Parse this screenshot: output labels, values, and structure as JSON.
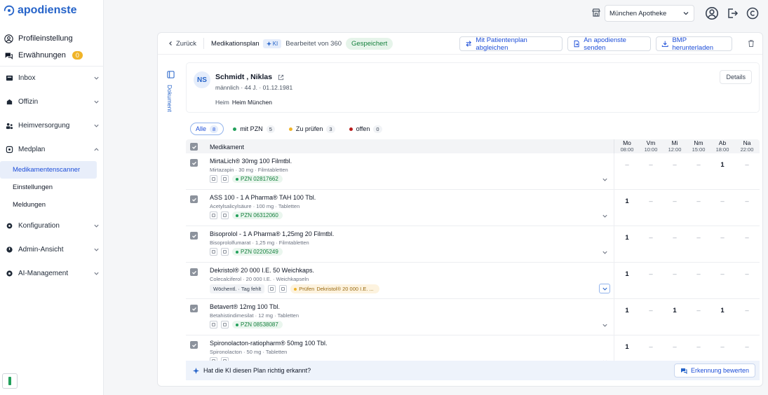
{
  "brand": {
    "name": "apodienste",
    "color": "#2563c9"
  },
  "sidebar": {
    "profile": "Profileinstellung",
    "mentions": {
      "label": "Erwähnungen",
      "count": "0"
    },
    "nav": [
      {
        "label": "Inbox",
        "icon": "inbox-icon"
      },
      {
        "label": "Offizin",
        "icon": "store-icon"
      },
      {
        "label": "Heimversorgung",
        "icon": "people-icon"
      },
      {
        "label": "Medplan",
        "icon": "medplan-icon",
        "expanded": true
      }
    ],
    "sub": [
      {
        "label": "Medikamentenscanner",
        "active": true
      },
      {
        "label": "Einstellungen"
      },
      {
        "label": "Meldungen"
      }
    ],
    "nav2": [
      {
        "label": "Konfiguration",
        "icon": "gear-icon"
      },
      {
        "label": "Admin-Ansicht",
        "icon": "shield-icon"
      },
      {
        "label": "AI-Management",
        "icon": "ai-icon"
      }
    ]
  },
  "topbar": {
    "pharmacy": "München Apotheke"
  },
  "header": {
    "back": "Zurück",
    "title": "Medikationsplan",
    "ki": "KI",
    "edited": "Bearbeitet von 360",
    "status": "Gespeichert",
    "btn_compare": "Mit Patientenplan abgleichen",
    "btn_send": "An apodienste senden",
    "btn_download": "BMP herunterladen"
  },
  "doc_tab": "Dokument",
  "patient": {
    "initials": "NS",
    "name": "Schmidt , Niklas",
    "gender": "männlich",
    "age": "44 J.",
    "dob": "01.12.1981",
    "heim_label": "Heim",
    "heim": "Heim München",
    "details": "Details"
  },
  "filters": [
    {
      "label": "Alle",
      "count": "8",
      "active": true,
      "dot": ""
    },
    {
      "label": "mit PZN",
      "count": "5",
      "dot": "#22a05b"
    },
    {
      "label": "Zu prüfen",
      "count": "3",
      "dot": "#f0b429"
    },
    {
      "label": "offen",
      "count": "0",
      "dot": "#b91c1c"
    }
  ],
  "table": {
    "col_name": "Medikament",
    "days": [
      {
        "label": "Mo",
        "time": "08:00"
      },
      {
        "label": "Vm",
        "time": "10:00"
      },
      {
        "label": "Mi",
        "time": "12:00"
      },
      {
        "label": "Nm",
        "time": "15:00"
      },
      {
        "label": "Ab",
        "time": "18:00"
      },
      {
        "label": "Na",
        "time": "22:00"
      }
    ],
    "rows": [
      {
        "name": "MirtaLich® 30mg 100 Filmtbl.",
        "sub": "Mirtazapin · 30 mg · Filmtabletten",
        "pzn": "PZN 02817662",
        "doses": [
          "–",
          "–",
          "–",
          "–",
          "1",
          "–"
        ]
      },
      {
        "name": "ASS 100 - 1 A Pharma® TAH 100 Tbl.",
        "sub": "Acetylsalicylsäure · 100 mg · Tabletten",
        "pzn": "PZN 06312060",
        "doses": [
          "1",
          "–",
          "–",
          "–",
          "–",
          "–"
        ]
      },
      {
        "name": "Bisoprolol - 1 A Pharma® 1,25mg 20 Filmtbl.",
        "sub": "Bisoprololfumarat · 1,25 mg · Filmtabletten",
        "pzn": "PZN 02205249",
        "doses": [
          "1",
          "–",
          "–",
          "–",
          "–",
          "–"
        ]
      },
      {
        "name": "Dekristol® 20 000 I.E. 50 Weichkaps.",
        "sub": "Colecalciferol · 20 000 I.E. · Weichkapseln",
        "weekly": "Wöchentl. · Tag fehlt",
        "warn_label": "Prüfen",
        "warn_text": "Dekristol® 20 000 I.E. ...",
        "doses": [
          "1",
          "–",
          "–",
          "–",
          "–",
          "–"
        ],
        "boxed": true
      },
      {
        "name": "Betavert® 12mg 100 Tbl.",
        "sub": "Betahistindimesilat · 12 mg · Tabletten",
        "pzn": "PZN 08538087",
        "doses": [
          "1",
          "–",
          "1",
          "–",
          "1",
          "–"
        ]
      },
      {
        "name": "Spironolacton-ratiopharm® 50mg 100 Tbl.",
        "sub": "Spironolacton · 50 mg · Tabletten",
        "doses": [
          "1",
          "–",
          "–",
          "–",
          "–",
          "–"
        ]
      }
    ]
  },
  "ki_bar": {
    "question": "Hat die KI diesen Plan richtig erkannt?",
    "button": "Erkennung bewerten"
  }
}
